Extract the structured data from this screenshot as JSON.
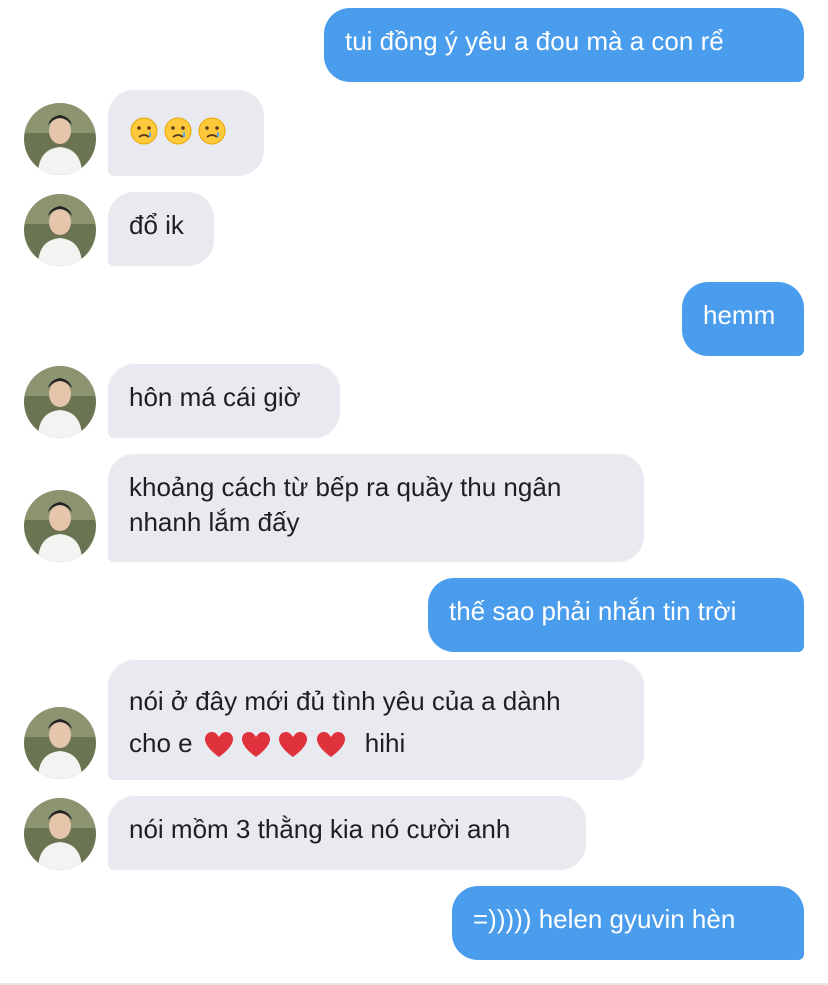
{
  "messages": [
    {
      "id": "m1",
      "side": "out",
      "text": "tui đồng ý yêu a đou mà a con rể"
    },
    {
      "id": "m2",
      "side": "in",
      "emoji": [
        "crying-face",
        "crying-face",
        "crying-face"
      ]
    },
    {
      "id": "m3",
      "side": "in",
      "text": "đổ ik"
    },
    {
      "id": "m4",
      "side": "out",
      "text": "hemm"
    },
    {
      "id": "m5",
      "side": "in",
      "text": "hôn má cái giờ"
    },
    {
      "id": "m6",
      "side": "in",
      "lines": [
        "khoảng cách từ bếp ra quầy thu ngân",
        "nhanh lắm đấy"
      ]
    },
    {
      "id": "m7",
      "side": "out",
      "text": "thế sao phải nhắn tin trời"
    },
    {
      "id": "m8",
      "side": "in",
      "line1": "nói ở đây mới đủ tình yêu của a dành",
      "line2_before": "cho e",
      "hearts": 4,
      "line2_after": "hihi"
    },
    {
      "id": "m9",
      "side": "in",
      "text": "nói mồm 3 thằng kia nó cười anh"
    },
    {
      "id": "m10",
      "side": "out",
      "text": "=))))) helen gyuvin hèn"
    }
  ],
  "colors": {
    "outgoing_bubble": "#4a9ced",
    "incoming_bubble": "#e8eaef",
    "incoming_text": "#1f1f1f",
    "outgoing_text": "#ffffff",
    "heart": "#e0323c"
  }
}
